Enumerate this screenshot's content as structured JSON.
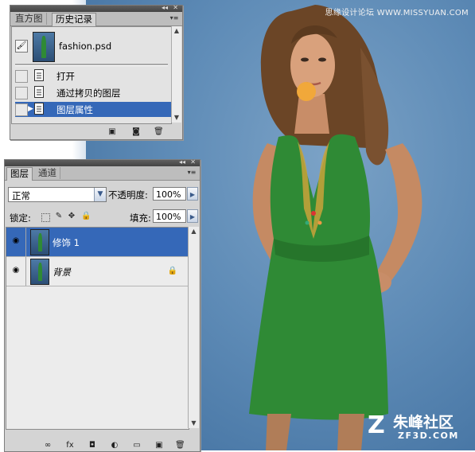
{
  "watermark": {
    "top": "思缘设计论坛 WWW.MISSYUAN.COM",
    "brand_cn": "朱峰社区",
    "brand_en": "ZF3D.COM"
  },
  "history_panel": {
    "tabs": [
      {
        "label": "直方图",
        "active": false
      },
      {
        "label": "历史记录",
        "active": true
      }
    ],
    "snapshot": {
      "name": "fashion.psd"
    },
    "items": [
      {
        "label": "打开",
        "selected": false
      },
      {
        "label": "通过拷贝的图层",
        "selected": false
      },
      {
        "label": "图层属性",
        "selected": true
      }
    ],
    "bottom_icons": [
      "new-document-icon",
      "camera-icon",
      "trash-icon"
    ]
  },
  "layers_panel": {
    "tabs": [
      {
        "label": "图层",
        "active": true
      },
      {
        "label": "通道",
        "active": false
      }
    ],
    "blend_mode": "正常",
    "opacity_label": "不透明度:",
    "opacity_value": "100%",
    "lock_label": "锁定:",
    "fill_label": "填充:",
    "fill_value": "100%",
    "layers": [
      {
        "name": "修饰 1",
        "selected": true,
        "locked": false
      },
      {
        "name": "背景",
        "selected": false,
        "locked": true
      }
    ]
  },
  "colors": {
    "selection": "#3568b8",
    "panel_bg": "#d4d4d4",
    "canvas_blue": "#5f8cb7",
    "dress_green": "#2f8a35"
  }
}
